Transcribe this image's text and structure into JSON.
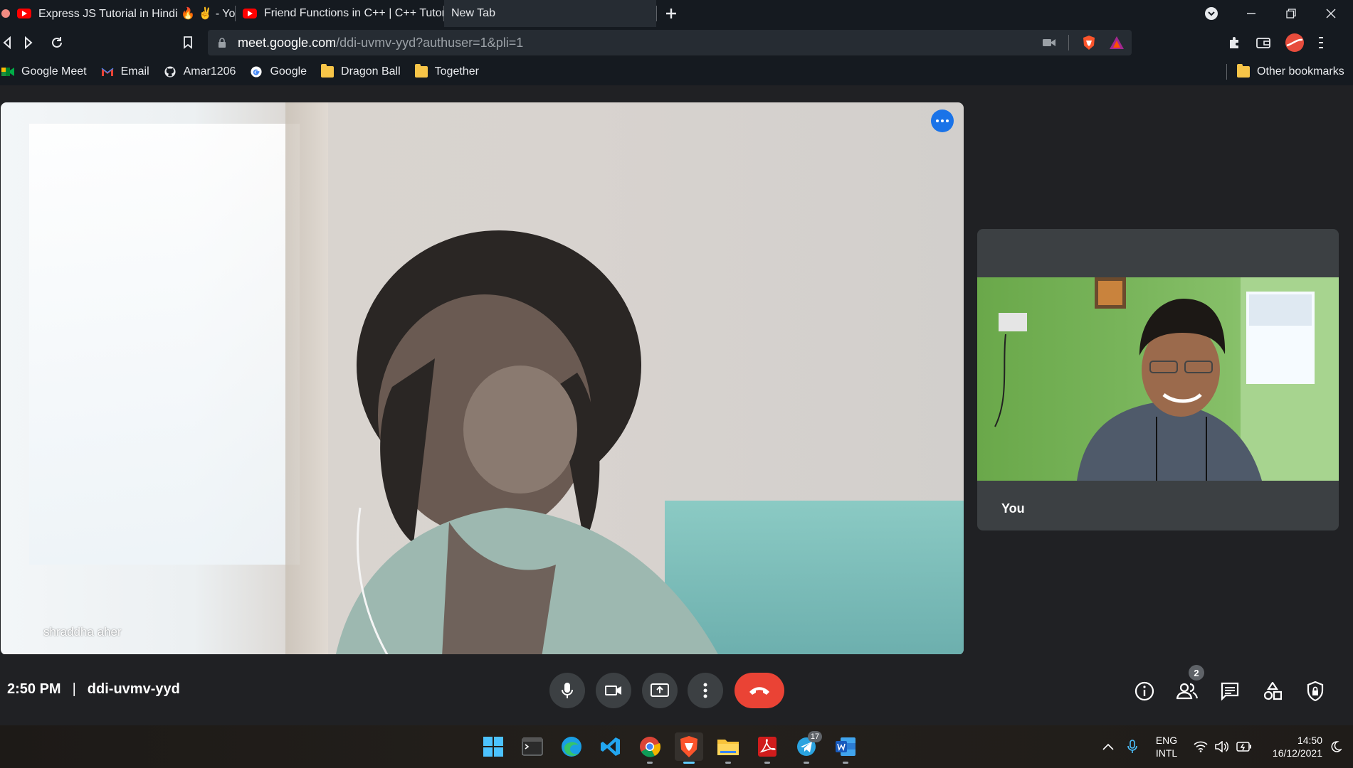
{
  "browser": {
    "tabs": [
      {
        "label": "Express JS Tutorial in Hindi 🔥 ✌️ - Yo",
        "icon": "youtube-icon"
      },
      {
        "label": "Friend Functions in C++ | C++ Tutoria",
        "icon": "youtube-icon"
      },
      {
        "label": "New Tab",
        "icon": ""
      }
    ],
    "url_host": "meet.google.com",
    "url_path": "/ddi-uvmv-yyd?authuser=1&pli=1",
    "bookmarks": [
      {
        "label": "Google Meet",
        "icon": "google-meet-icon"
      },
      {
        "label": "Email",
        "icon": "gmail-icon"
      },
      {
        "label": "Amar1206",
        "icon": "github-icon"
      },
      {
        "label": "Google",
        "icon": "google-icon"
      },
      {
        "label": "Dragon Ball",
        "icon": "folder-icon"
      },
      {
        "label": "Together",
        "icon": "folder-icon"
      }
    ],
    "other_bookmarks": "Other bookmarks"
  },
  "meet": {
    "main_participant": "shraddha aher",
    "self_label": "You",
    "time": "2:50 PM",
    "separator": "|",
    "meeting_code": "ddi-uvmv-yyd",
    "participant_count": "2",
    "colors": {
      "hangup": "#ea4335",
      "accent": "#1a73e8",
      "background": "#202124",
      "tile": "#3c4043"
    }
  },
  "taskbar": {
    "apps": [
      "windows-start-icon",
      "terminal-icon",
      "edge-icon",
      "vscode-icon",
      "chrome-icon",
      "brave-icon",
      "file-explorer-icon",
      "acrobat-icon",
      "telegram-icon",
      "word-icon"
    ],
    "telegram_badge": "17",
    "lang_top": "ENG",
    "lang_bottom": "INTL",
    "clock_time": "14:50",
    "clock_date": "16/12/2021"
  }
}
